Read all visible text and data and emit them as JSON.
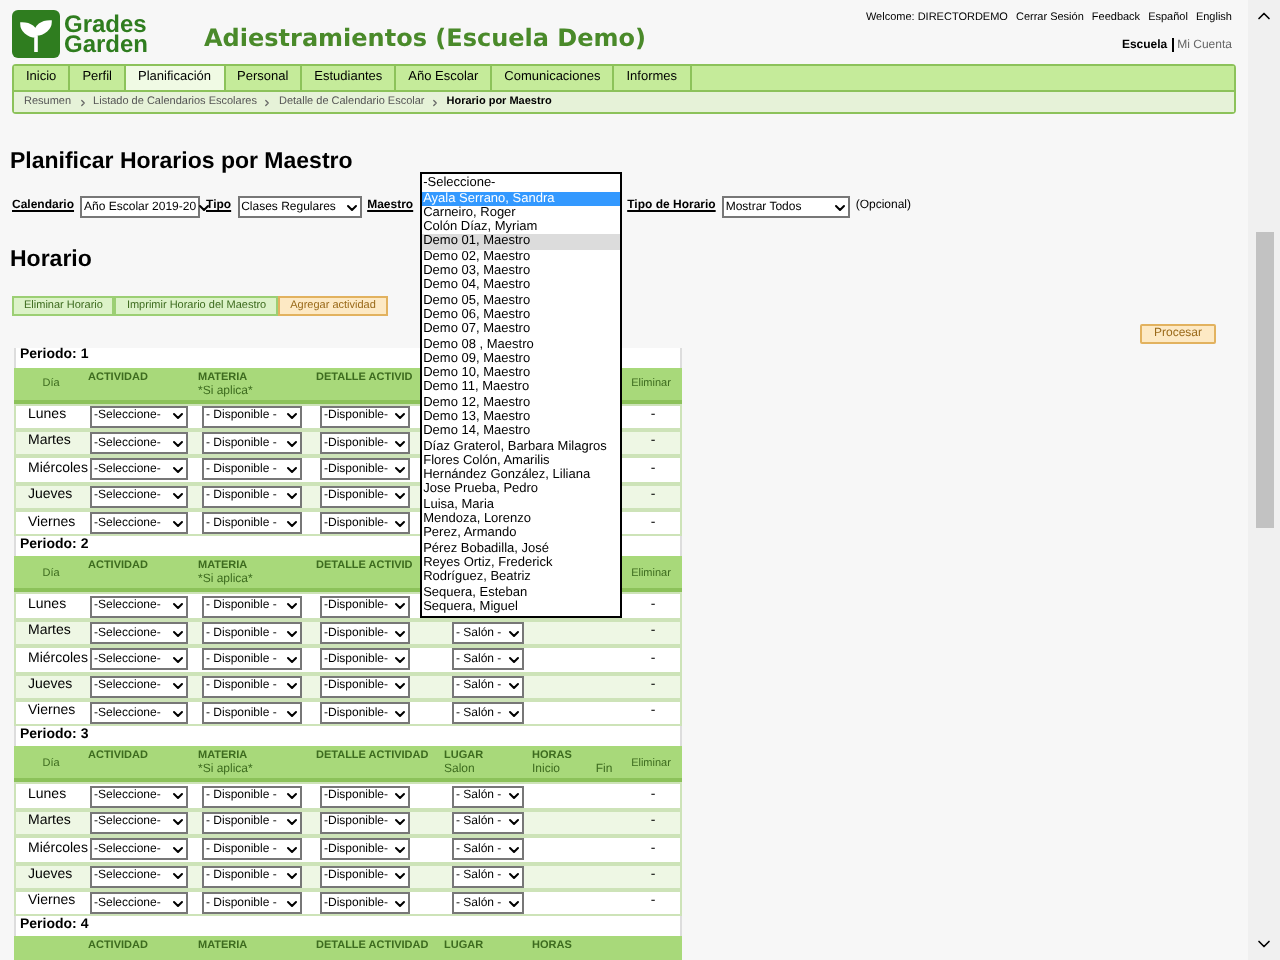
{
  "header": {
    "logo_line1": "Grades",
    "logo_line2": "Garden",
    "title": "Adiestramientos (Escuela Demo)",
    "welcome": "Welcome: DIRECTORDEMO",
    "links": [
      "Cerrar Sesión",
      "Feedback",
      "Español",
      "English"
    ],
    "context": "Escuela",
    "account": "Mi Cuenta"
  },
  "nav": [
    {
      "label": "Inicio",
      "selected": false
    },
    {
      "label": "Perfil",
      "selected": false
    },
    {
      "label": "Planificación",
      "selected": true
    },
    {
      "label": "Personal",
      "selected": false
    },
    {
      "label": "Estudiantes",
      "selected": false
    },
    {
      "label": "Año Escolar",
      "selected": false
    },
    {
      "label": "Comunicaciones",
      "selected": false
    },
    {
      "label": "Informes",
      "selected": false
    }
  ],
  "breadcrumb": [
    {
      "label": "Resumen",
      "current": false
    },
    {
      "label": "Listado de Calendarios Escolares",
      "current": false
    },
    {
      "label": "Detalle de Calendario Escolar",
      "current": false
    },
    {
      "label": "Horario por Maestro",
      "current": true
    }
  ],
  "page_title": "Planificar Horarios por Maestro",
  "filters": {
    "calendar_label": "Calendario",
    "calendar_value": "Año Escolar 2019-20",
    "type_label": "Tipo",
    "type_value": "Clases Regulares",
    "teacher_label": "Maestro",
    "schedule_type_label": "Tipo de Horario",
    "schedule_type_value": "Mostrar Todos",
    "optional_note": "(Opcional)"
  },
  "teacher_options": [
    {
      "label": "-Seleccione-",
      "selected": false,
      "hovered": false
    },
    {
      "label": "Ayala Serrano, Sandra",
      "selected": true,
      "hovered": false
    },
    {
      "label": "Carneiro, Roger",
      "selected": false,
      "hovered": false
    },
    {
      "label": "Colón Díaz, Myriam",
      "selected": false,
      "hovered": false
    },
    {
      "label": "Demo 01, Maestro",
      "selected": false,
      "hovered": true
    },
    {
      "label": "Demo 02, Maestro",
      "selected": false,
      "hovered": false
    },
    {
      "label": "Demo 03, Maestro",
      "selected": false,
      "hovered": false
    },
    {
      "label": "Demo 04, Maestro",
      "selected": false,
      "hovered": false
    },
    {
      "label": "Demo 05, Maestro",
      "selected": false,
      "hovered": false
    },
    {
      "label": "Demo 06, Maestro",
      "selected": false,
      "hovered": false
    },
    {
      "label": "Demo 07, Maestro",
      "selected": false,
      "hovered": false
    },
    {
      "label": "Demo 08 , Maestro",
      "selected": false,
      "hovered": false
    },
    {
      "label": "Demo 09, Maestro",
      "selected": false,
      "hovered": false
    },
    {
      "label": "Demo 10, Maestro",
      "selected": false,
      "hovered": false
    },
    {
      "label": "Demo 11, Maestro",
      "selected": false,
      "hovered": false
    },
    {
      "label": "Demo 12, Maestro",
      "selected": false,
      "hovered": false
    },
    {
      "label": "Demo 13, Maestro",
      "selected": false,
      "hovered": false
    },
    {
      "label": "Demo 14, Maestro",
      "selected": false,
      "hovered": false
    },
    {
      "label": "Díaz Graterol, Barbara Milagros",
      "selected": false,
      "hovered": false
    },
    {
      "label": "Flores Colón, Amarilis",
      "selected": false,
      "hovered": false
    },
    {
      "label": "Hernández González, Liliana",
      "selected": false,
      "hovered": false
    },
    {
      "label": "Jose Prueba, Pedro",
      "selected": false,
      "hovered": false
    },
    {
      "label": "Luisa, Maria",
      "selected": false,
      "hovered": false
    },
    {
      "label": "Mendoza, Lorenzo",
      "selected": false,
      "hovered": false
    },
    {
      "label": "Perez, Armando",
      "selected": false,
      "hovered": false
    },
    {
      "label": "Pérez Bobadilla, José",
      "selected": false,
      "hovered": false
    },
    {
      "label": "Reyes Ortiz, Frederick",
      "selected": false,
      "hovered": false
    },
    {
      "label": "Rodríguez, Beatriz",
      "selected": false,
      "hovered": false
    },
    {
      "label": "Sequera, Esteban",
      "selected": false,
      "hovered": false
    },
    {
      "label": "Sequera, Miguel",
      "selected": false,
      "hovered": false
    }
  ],
  "section_title": "Horario",
  "actions": [
    {
      "label": "Eliminar Horario",
      "kind": "normal"
    },
    {
      "label": "Imprimir Horario del Maestro",
      "kind": "normal"
    },
    {
      "label": "Agregar actividad",
      "kind": "highlight"
    }
  ],
  "process_button": "Procesar",
  "periods": [
    {
      "label": "Periodo: 1",
      "columns": [
        {
          "kind": "day",
          "label": "Día"
        },
        {
          "kind": "activity",
          "label": "ACTIVIDAD"
        },
        {
          "kind": "subject",
          "label": "MATERIA",
          "sub": "*Si aplica*"
        },
        {
          "kind": "detail",
          "label": "DETALLE ACTIVID"
        },
        {
          "kind": "remove",
          "label": "Eliminar"
        }
      ],
      "rows": [
        {
          "day": "Lunes",
          "activity": "-Seleccione-",
          "subject": "- Disponible -",
          "detail": "-Disponible-",
          "remove": "-"
        },
        {
          "day": "Martes",
          "activity": "-Seleccione-",
          "subject": "- Disponible -",
          "detail": "-Disponible-",
          "remove": "-"
        },
        {
          "day": "Miércoles",
          "activity": "-Seleccione-",
          "subject": "- Disponible -",
          "detail": "-Disponible-",
          "remove": "-"
        },
        {
          "day": "Jueves",
          "activity": "-Seleccione-",
          "subject": "- Disponible -",
          "detail": "-Disponible-",
          "remove": "-"
        },
        {
          "day": "Viernes",
          "activity": "-Seleccione-",
          "subject": "- Disponible -",
          "detail": "-Disponible-",
          "remove": "-"
        }
      ]
    },
    {
      "label": "Periodo: 2",
      "columns": [
        {
          "kind": "day",
          "label": "Día"
        },
        {
          "kind": "activity",
          "label": "ACTIVIDAD"
        },
        {
          "kind": "subject",
          "label": "MATERIA",
          "sub": "*Si aplica*"
        },
        {
          "kind": "detail",
          "label": "DETALLE ACTIVID"
        },
        {
          "kind": "remove",
          "label": "Eliminar"
        }
      ],
      "rows": [
        {
          "day": "Lunes",
          "activity": "-Seleccione-",
          "subject": "- Disponible -",
          "detail": "-Disponible-",
          "remove": "-"
        },
        {
          "day": "Martes",
          "activity": "-Seleccione-",
          "subject": "- Disponible -",
          "detail": "-Disponible-",
          "place": "- Salón -",
          "remove": "-"
        },
        {
          "day": "Miércoles",
          "activity": "-Seleccione-",
          "subject": "- Disponible -",
          "detail": "-Disponible-",
          "place": "- Salón -",
          "remove": "-"
        },
        {
          "day": "Jueves",
          "activity": "-Seleccione-",
          "subject": "- Disponible -",
          "detail": "-Disponible-",
          "place": "- Salón -",
          "remove": "-"
        },
        {
          "day": "Viernes",
          "activity": "-Seleccione-",
          "subject": "- Disponible -",
          "detail": "-Disponible-",
          "place": "- Salón -",
          "remove": "-"
        }
      ]
    },
    {
      "label": "Periodo: 3",
      "columns": [
        {
          "kind": "day",
          "label": "Día"
        },
        {
          "kind": "activity",
          "label": "ACTIVIDAD"
        },
        {
          "kind": "subject",
          "label": "MATERIA",
          "sub": "*Si aplica*"
        },
        {
          "kind": "detail",
          "label": "DETALLE ACTIVIDAD"
        },
        {
          "kind": "place",
          "label": "LUGAR",
          "sub": "Salon"
        },
        {
          "kind": "hours",
          "label": "HORAS",
          "sub": "Inicio"
        },
        {
          "kind": "end",
          "sub": "Fin"
        },
        {
          "kind": "remove",
          "label": "Eliminar"
        }
      ],
      "rows": [
        {
          "day": "Lunes",
          "activity": "-Seleccione-",
          "subject": "- Disponible -",
          "detail": "-Disponible-",
          "place": "- Salón -",
          "remove": "-"
        },
        {
          "day": "Martes",
          "activity": "-Seleccione-",
          "subject": "- Disponible -",
          "detail": "-Disponible-",
          "place": "- Salón -",
          "remove": "-"
        },
        {
          "day": "Miércoles",
          "activity": "-Seleccione-",
          "subject": "- Disponible -",
          "detail": "-Disponible-",
          "place": "- Salón -",
          "remove": "-"
        },
        {
          "day": "Jueves",
          "activity": "-Seleccione-",
          "subject": "- Disponible -",
          "detail": "-Disponible-",
          "place": "- Salón -",
          "remove": "-"
        },
        {
          "day": "Viernes",
          "activity": "-Seleccione-",
          "subject": "- Disponible -",
          "detail": "-Disponible-",
          "place": "- Salón -",
          "remove": "-"
        }
      ]
    },
    {
      "label": "Periodo: 4",
      "columns": [
        {
          "kind": "activity",
          "label": "ACTIVIDAD"
        },
        {
          "kind": "subject",
          "label": "MATERIA"
        },
        {
          "kind": "detail",
          "label": "DETALLE ACTIVIDAD"
        },
        {
          "kind": "place",
          "label": "LUGAR"
        },
        {
          "kind": "hours",
          "label": "HORAS"
        }
      ]
    }
  ]
}
